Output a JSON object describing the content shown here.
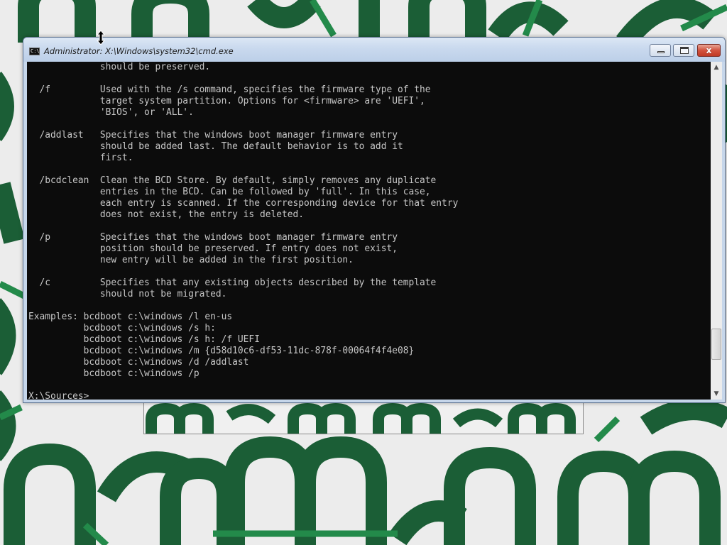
{
  "window": {
    "title": "Administrator: X:\\Windows\\system32\\cmd.exe",
    "icon": "cmd-icon",
    "icon_text": "C:\\",
    "buttons": {
      "minimize": "minimize-icon",
      "maximize": "maximize-icon",
      "close": "close-icon",
      "close_glyph": "x"
    }
  },
  "console": {
    "lines": [
      "             should be preserved.",
      "",
      "  /f         Used with the /s command, specifies the firmware type of the",
      "             target system partition. Options for <firmware> are 'UEFI',",
      "             'BIOS', or 'ALL'.",
      "",
      "  /addlast   Specifies that the windows boot manager firmware entry",
      "             should be added last. The default behavior is to add it",
      "             first.",
      "",
      "  /bcdclean  Clean the BCD Store. By default, simply removes any duplicate",
      "             entries in the BCD. Can be followed by 'full'. In this case,",
      "             each entry is scanned. If the corresponding device for that entry",
      "             does not exist, the entry is deleted.",
      "",
      "  /p         Specifies that the windows boot manager firmware entry",
      "             position should be preserved. If entry does not exist,",
      "             new entry will be added in the first position.",
      "",
      "  /c         Specifies that any existing objects described by the template",
      "             should not be migrated.",
      "",
      "Examples: bcdboot c:\\windows /l en-us",
      "          bcdboot c:\\windows /s h:",
      "          bcdboot c:\\windows /s h: /f UEFI",
      "          bcdboot c:\\windows /m {d58d10c6-df53-11dc-878f-00064f4f4e08}",
      "          bcdboot c:\\windows /d /addlast",
      "          bcdboot c:\\windows /p",
      "",
      "X:\\Sources>"
    ]
  },
  "scrollbar": {
    "up_arrow": "▲",
    "down_arrow": "▼",
    "position_fraction": 0.9
  },
  "colors": {
    "console_bg": "#0c0c0c",
    "console_fg": "#c7c7c7",
    "wallpaper_bg": "#ececec",
    "wallpaper_accent": "#1b5e36",
    "titlebar": "#c9d9ee",
    "close_button": "#c94a35"
  },
  "cursor": "resize-vertical-icon"
}
